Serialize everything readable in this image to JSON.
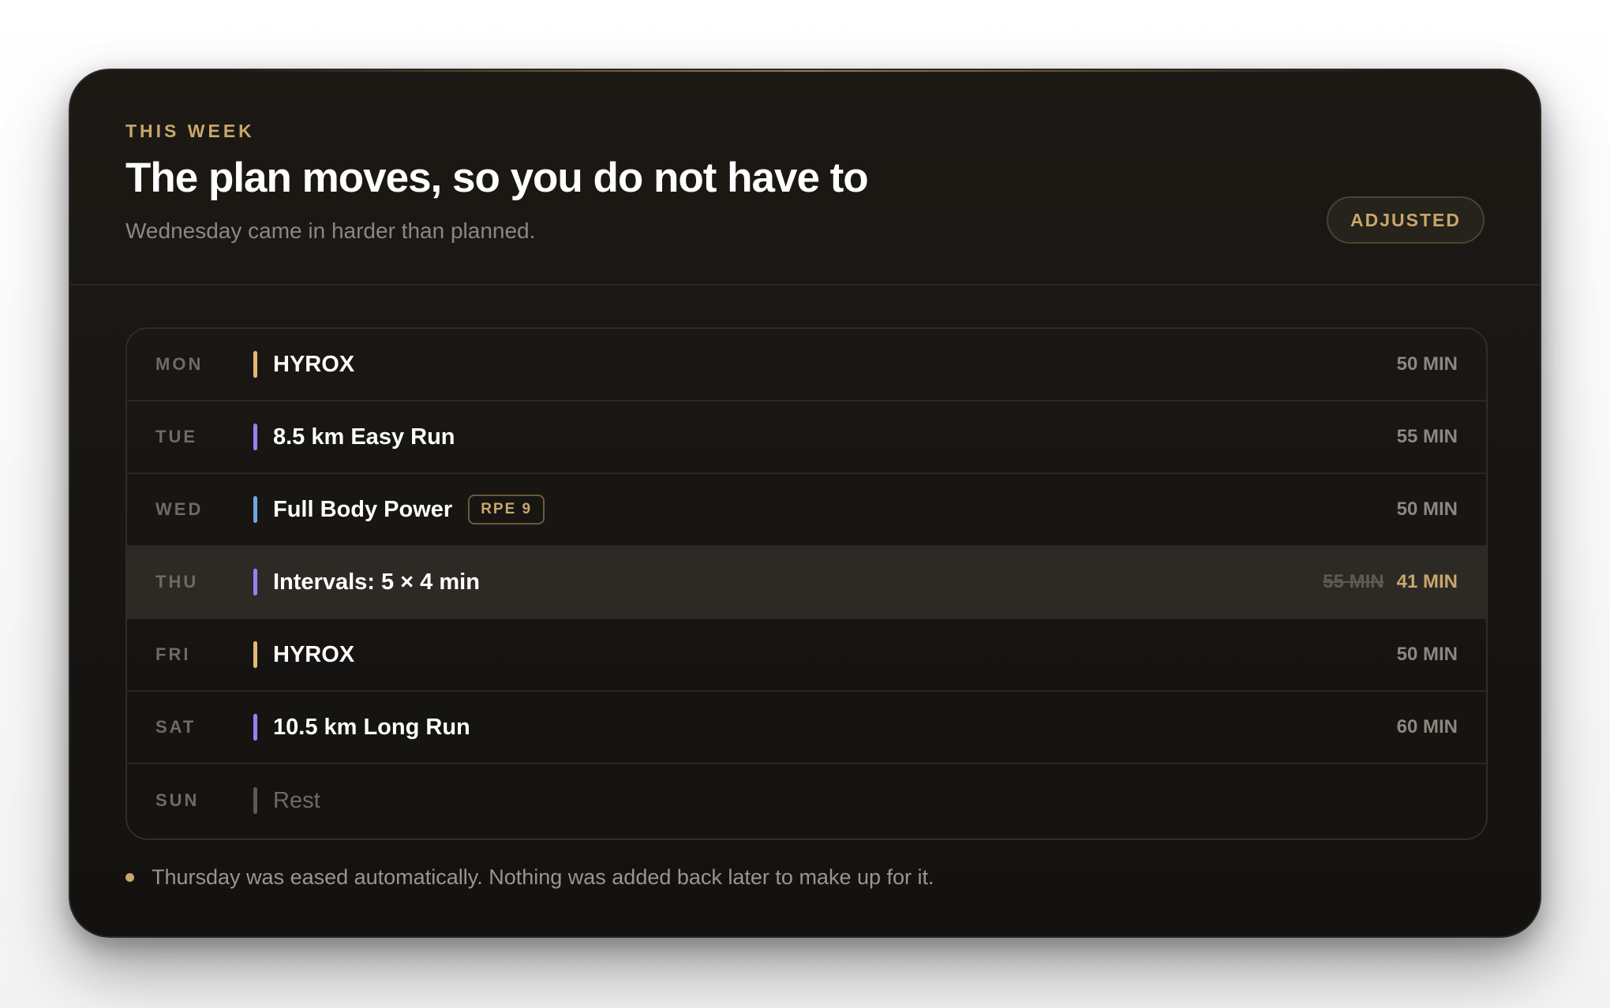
{
  "header": {
    "eyebrow": "THIS WEEK",
    "title": "The plan moves, so you do not have to",
    "subtitle": "Wednesday came in harder than planned.",
    "badge": "ADJUSTED"
  },
  "colors": {
    "accent_gold": "#c9a66b",
    "bar_gold": "#e3b875",
    "bar_purple": "#9b7ff0",
    "bar_blue": "#6ea6e6",
    "bar_gray": "#5d5953"
  },
  "rows": [
    {
      "day": "MON",
      "name": "HYROX",
      "duration": "50 MIN",
      "bar_color": "#e3b875"
    },
    {
      "day": "TUE",
      "name": "8.5 km Easy Run",
      "duration": "55 MIN",
      "bar_color": "#9b7ff0"
    },
    {
      "day": "WED",
      "name": "Full Body Power",
      "tag": "RPE 9",
      "duration": "50 MIN",
      "bar_color": "#6ea6e6"
    },
    {
      "day": "THU",
      "name": "Intervals: 5 × 4 min",
      "old_duration": "55 MIN",
      "duration": "41 MIN",
      "bar_color": "#9b7ff0"
    },
    {
      "day": "FRI",
      "name": "HYROX",
      "duration": "50 MIN",
      "bar_color": "#e3b875"
    },
    {
      "day": "SAT",
      "name": "10.5 km Long Run",
      "duration": "60 MIN",
      "bar_color": "#9b7ff0"
    },
    {
      "day": "SUN",
      "name": "Rest",
      "bar_color": "#5d5953"
    }
  ],
  "footnote": "Thursday was eased automatically. Nothing was added back later to make up for it."
}
